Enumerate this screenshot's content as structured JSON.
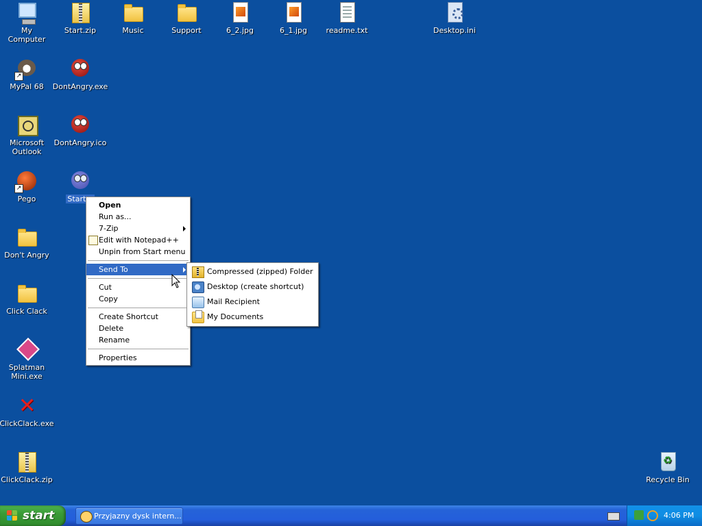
{
  "desktop": {
    "icons": [
      {
        "label": "My Computer"
      },
      {
        "label": "Start.zip"
      },
      {
        "label": "Music"
      },
      {
        "label": "Support"
      },
      {
        "label": "6_2.jpg"
      },
      {
        "label": "6_1.jpg"
      },
      {
        "label": "readme.txt"
      },
      {
        "label": "Desktop.ini"
      },
      {
        "label": "MyPal 68"
      },
      {
        "label": "DontAngry.exe"
      },
      {
        "label": "Microsoft Outlook"
      },
      {
        "label": "DontAngry.ico"
      },
      {
        "label": "Pego"
      },
      {
        "label": "Start.e"
      },
      {
        "label": "Don't Angry"
      },
      {
        "label": "Click Clack"
      },
      {
        "label": "Splatman Mini.exe"
      },
      {
        "label": "ClickClack.exe"
      },
      {
        "label": "ClickClack.zip"
      },
      {
        "label": "Recycle Bin"
      }
    ]
  },
  "context_menu": {
    "items": [
      {
        "label": "Open"
      },
      {
        "label": "Run as..."
      },
      {
        "label": "7-Zip"
      },
      {
        "label": "Edit with Notepad++"
      },
      {
        "label": "Unpin from Start menu"
      },
      {
        "label": "Send To"
      },
      {
        "label": "Cut"
      },
      {
        "label": "Copy"
      },
      {
        "label": "Create Shortcut"
      },
      {
        "label": "Delete"
      },
      {
        "label": "Rename"
      },
      {
        "label": "Properties"
      }
    ]
  },
  "send_to_menu": {
    "items": [
      {
        "label": "Compressed (zipped) Folder"
      },
      {
        "label": "Desktop (create shortcut)"
      },
      {
        "label": "Mail Recipient"
      },
      {
        "label": "My Documents"
      }
    ]
  },
  "taskbar": {
    "start_label": "start",
    "task_label": "Przyjazny dysk intern...",
    "clock": "4:06 PM"
  },
  "colors": {
    "desktop_background": "#0b4f9f",
    "menu_highlight": "#316ac5",
    "start_button": "#3a9b37",
    "taskbar": "#245edb"
  }
}
